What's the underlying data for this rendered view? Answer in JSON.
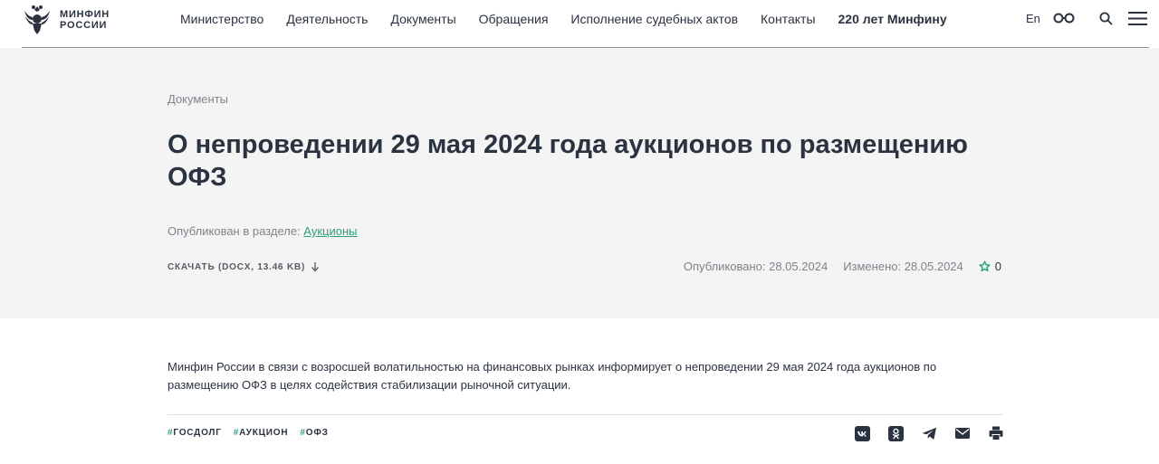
{
  "logo": {
    "line1": "МИНФИН",
    "line2": "РОССИИ"
  },
  "nav": {
    "items": [
      {
        "label": "Министерство"
      },
      {
        "label": "Деятельность"
      },
      {
        "label": "Документы"
      },
      {
        "label": "Обращения"
      },
      {
        "label": "Исполнение судебных актов"
      },
      {
        "label": "Контакты"
      },
      {
        "label": "220 лет Минфину"
      }
    ],
    "lang": "En"
  },
  "page": {
    "breadcrumb": "Документы",
    "title": "О непроведении 29 мая 2024 года аукционов по размещению ОФЗ",
    "section_prefix": "Опубликован в разделе:",
    "section_link": "Аукционы",
    "download_label": "СКАЧАТЬ (DOCX, 13.46 KB)",
    "published": "Опубликовано: 28.05.2024",
    "modified": "Изменено: 28.05.2024",
    "favorites_count": "0"
  },
  "article": {
    "text": "Минфин России в связи с возросшей волатильностью на финансовых рынках информирует о непроведении 29 мая 2024 года аукционов по размещению ОФЗ в целях содействия стабилизации рыночной ситуации."
  },
  "tags": [
    {
      "hash": "#",
      "label": "ГОСДОЛГ"
    },
    {
      "hash": "#",
      "label": "АУКЦИОН"
    },
    {
      "hash": "#",
      "label": "ОФЗ"
    }
  ],
  "share": [
    "vk-icon",
    "ok-icon",
    "telegram-icon",
    "mail-icon",
    "print-icon"
  ],
  "colors": {
    "accent": "#2e9e7e",
    "text": "#2b3240",
    "muted": "#7e838c",
    "hero_bg": "#f4f4f4"
  }
}
